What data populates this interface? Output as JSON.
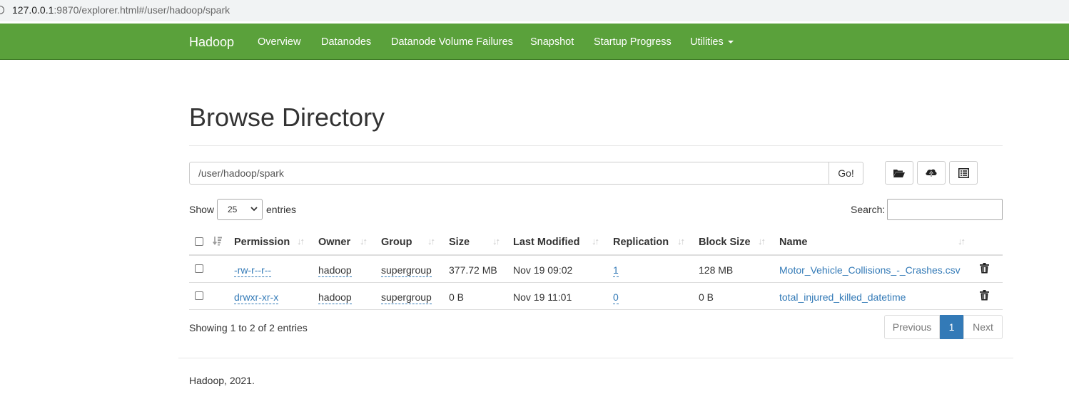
{
  "browser": {
    "url_host": "127.0.0.1",
    "url_path": ":9870/explorer.html#/user/hadoop/spark"
  },
  "navbar": {
    "brand": "Hadoop",
    "items": [
      "Overview",
      "Datanodes",
      "Datanode Volume Failures",
      "Snapshot",
      "Startup Progress",
      "Utilities"
    ],
    "color": "#5aa13b"
  },
  "page": {
    "title": "Browse Directory",
    "path_value": "/user/hadoop/spark",
    "go_label": "Go!",
    "show_label": "Show",
    "entries_value": "25",
    "entries_label": "entries",
    "search_label": "Search:"
  },
  "table": {
    "headers": [
      "Permission",
      "Owner",
      "Group",
      "Size",
      "Last Modified",
      "Replication",
      "Block Size",
      "Name"
    ],
    "rows": [
      {
        "permission": "-rw-r--r--",
        "owner": "hadoop",
        "group": "supergroup",
        "size": "377.72 MB",
        "modified": "Nov 19 09:02",
        "replication": "1",
        "block_size": "128 MB",
        "name": "Motor_Vehicle_Collisions_-_Crashes.csv"
      },
      {
        "permission": "drwxr-xr-x",
        "owner": "hadoop",
        "group": "supergroup",
        "size": "0 B",
        "modified": "Nov 19 11:01",
        "replication": "0",
        "block_size": "0 B",
        "name": "total_injured_killed_datetime"
      }
    ]
  },
  "pagination": {
    "info": "Showing 1 to 2 of 2 entries",
    "previous": "Previous",
    "current": "1",
    "next": "Next"
  },
  "footer": {
    "text": "Hadoop, 2021."
  }
}
